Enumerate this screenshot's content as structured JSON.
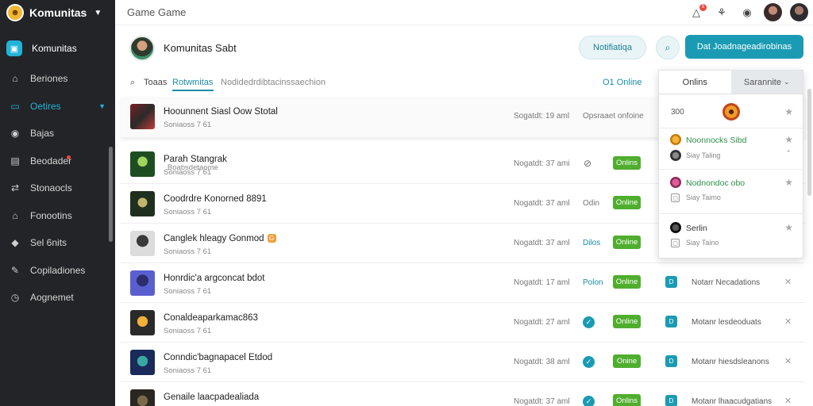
{
  "brand": {
    "name": "Komunitas"
  },
  "sidebar": {
    "items": [
      {
        "label": "Komunitas",
        "icon": "app-icon"
      },
      {
        "label": "Beriones",
        "icon": "home-icon"
      },
      {
        "label": "Oetires",
        "icon": "folder-icon"
      },
      {
        "label": "Bajas",
        "icon": "compass-icon"
      },
      {
        "label": "Beodader",
        "icon": "book-icon"
      },
      {
        "label": "Stonaocls",
        "icon": "swap-icon"
      },
      {
        "label": "Fonootins",
        "icon": "house-icon"
      },
      {
        "label": "Sel 6nits",
        "icon": "shield-icon"
      },
      {
        "label": "Copiladiones",
        "icon": "pen-icon"
      },
      {
        "label": "Aognemet",
        "icon": "clock-icon"
      }
    ]
  },
  "topbar": {
    "title": "Game  Game",
    "badge_count": "5"
  },
  "header": {
    "title": "Komunitas Sabt",
    "notify_label": "Notifiatiqa",
    "primary_label": "Dat Joadnageadirobinas"
  },
  "tabs": {
    "all": "Toaas",
    "active": "Rotwmitas",
    "rest": "Nodidedrdibtacinssaechion",
    "online": "O1 Online"
  },
  "rows": [
    {
      "name": "Hoounnent Siasl Oow Stotal",
      "sub": "Soniaoss 7 61",
      "time": "Sogatdt: 19 aml",
      "col3": "Opsraaet onfoine",
      "col3_type": "text",
      "badge": "",
      "note": "",
      "thumb": "t1",
      "mini": ""
    },
    {
      "name": "Parah Stangrak",
      "sub": "Soniaoss 7 61",
      "sub_extra": "Boabsdetaome",
      "time": "Nogatdt: 37 ami",
      "col3": "",
      "col3_type": "link",
      "badge": "Onlins",
      "note": "",
      "thumb": "t2",
      "mini": ""
    },
    {
      "name": "Coodrdre Konorned 8891",
      "sub": "Soniaoss 7 61",
      "time": "Nogatdt: 37 aml",
      "col3": "Odin",
      "col3_type": "plain",
      "badge": "Online",
      "note": "",
      "thumb": "t3",
      "mini": ""
    },
    {
      "name": "Canglek hleagy Gonmod",
      "sub": "Soniaoss 7 61",
      "time": "Nogatdt: 37 aml",
      "col3": "Dilos",
      "col3_type": "text",
      "badge": "Online",
      "note": "",
      "thumb": "t4",
      "mini": "G"
    },
    {
      "name": "Honrdic'a argconcat bdot",
      "sub": "Soniaoss 7 61",
      "time": "Nogatdt: 17 aml",
      "col3": "Polon",
      "col3_type": "text",
      "badge": "Online",
      "note": "Notarr Necadations",
      "thumb": "t5",
      "mini": ""
    },
    {
      "name": "Conaldeaparkamac863",
      "sub": "Soniaoss 7 61",
      "time": "Nogatdt: 27 aml",
      "col3": "",
      "col3_type": "check",
      "badge": "Online",
      "note": "Motanr lesdeoduats",
      "thumb": "t6",
      "mini": ""
    },
    {
      "name": "Conndic'bagnapacel Etdod",
      "sub": "Soniaoss 7 61",
      "time": "Nogatdt: 38 aml",
      "col3": "",
      "col3_type": "check",
      "badge": "Onine",
      "note": "Motanr hiesdsleanons",
      "thumb": "t7",
      "mini": ""
    },
    {
      "name": "Genaile laacpadealiada",
      "sub": "",
      "time": "Nogatdt: 37 aml",
      "col3": "",
      "col3_type": "check",
      "badge": "Onlins",
      "note": "Motanr lhaacudgatians",
      "thumb": "t8",
      "mini": ""
    }
  ],
  "panel": {
    "tab_left": "Onlins",
    "tab_right": "Sarannite",
    "count": "300",
    "items": [
      {
        "name": "Noonnocks Sibd",
        "sub": "Siay Taling",
        "green": true
      },
      {
        "name": "Nodnondoc obo",
        "sub": "Siay Taimo",
        "green": true
      },
      {
        "name": "Serlin",
        "sub": "Siay Taino",
        "green": false
      }
    ]
  },
  "colors": {
    "accent": "#1a9bb3",
    "online_green": "#4fae2e",
    "sidebar_bg": "#222427",
    "alert_red": "#e94a3f"
  }
}
